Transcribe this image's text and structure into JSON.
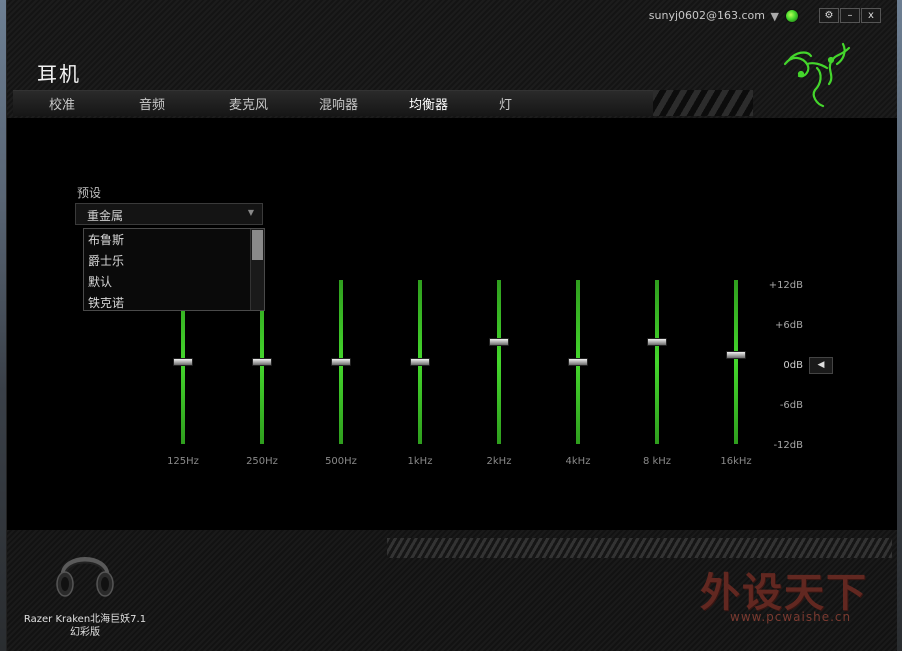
{
  "header": {
    "account_email": "sunyj0602@163.com",
    "title": "耳机",
    "window_buttons": {
      "settings": "⚙",
      "minimize": "–",
      "close": "x"
    }
  },
  "tabs": [
    {
      "label": "校准",
      "active": false
    },
    {
      "label": "音频",
      "active": false
    },
    {
      "label": "麦克风",
      "active": false
    },
    {
      "label": "混响器",
      "active": false
    },
    {
      "label": "均衡器",
      "active": true
    },
    {
      "label": "灯",
      "active": false
    }
  ],
  "equalizer": {
    "preset_label": "预设",
    "preset_selected": "重金属",
    "preset_options": [
      "布鲁斯",
      "爵士乐",
      "默认",
      "铁克诺"
    ],
    "bands": [
      {
        "label": "125Hz",
        "gain_db": 0
      },
      {
        "label": "250Hz",
        "gain_db": 0
      },
      {
        "label": "500Hz",
        "gain_db": 0
      },
      {
        "label": "1kHz",
        "gain_db": 0
      },
      {
        "label": "2kHz",
        "gain_db": 3
      },
      {
        "label": "4kHz",
        "gain_db": 0
      },
      {
        "label": "8 kHz",
        "gain_db": 3
      },
      {
        "label": "16kHz",
        "gain_db": 1
      }
    ],
    "scale": [
      "+12dB",
      "+6dB",
      "0dB",
      "-6dB",
      "-12dB"
    ],
    "collapse_arrow": "◀"
  },
  "footer": {
    "device_name_line1": "Razer Kraken北海巨妖7.1",
    "device_name_line2": "幻彩版"
  },
  "watermark": {
    "text": "外设天下",
    "url": "www.pcwaishe.cn"
  },
  "colors": {
    "accent_green": "#44d62c",
    "background": "#000000"
  }
}
